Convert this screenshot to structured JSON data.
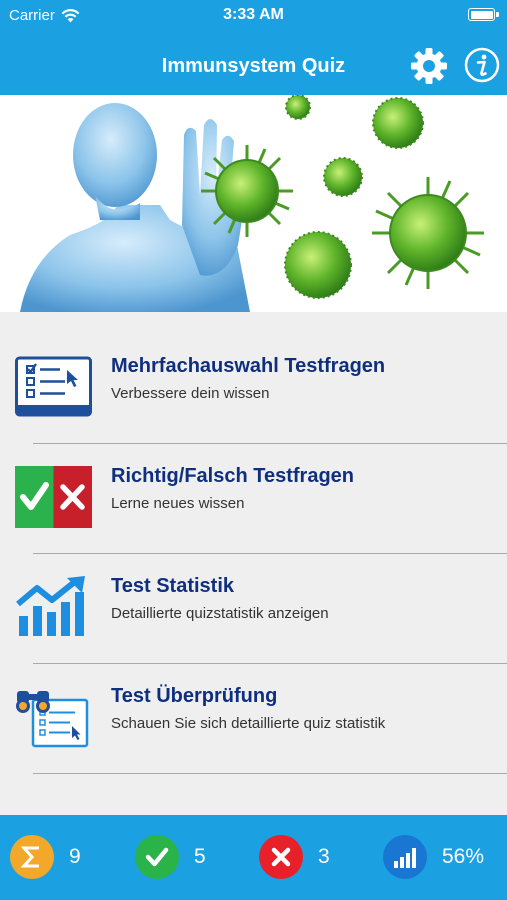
{
  "status_bar": {
    "carrier": "Carrier",
    "time": "3:33 AM"
  },
  "nav": {
    "title": "Immunsystem Quiz",
    "settings_icon": "gear-icon",
    "info_icon": "info-icon"
  },
  "menu": [
    {
      "title": "Mehrfachauswahl Testfragen",
      "subtitle": "Verbessere dein wissen",
      "icon": "checklist-icon"
    },
    {
      "title": "Richtig/Falsch Testfragen",
      "subtitle": "Lerne neues wissen",
      "icon": "true-false-icon"
    },
    {
      "title": "Test Statistik",
      "subtitle": "Detaillierte quizstatistik anzeigen",
      "icon": "chart-icon"
    },
    {
      "title": "Test Überprüfung",
      "subtitle": "Schauen Sie sich detaillierte quiz statistik",
      "icon": "binoculars-list-icon"
    }
  ],
  "stats": {
    "total": {
      "value": "9",
      "icon": "sigma-icon"
    },
    "correct": {
      "value": "5",
      "icon": "check-icon"
    },
    "wrong": {
      "value": "3",
      "icon": "x-icon"
    },
    "percent": {
      "value": "56%",
      "icon": "signal-bars-icon"
    }
  },
  "colors": {
    "primary": "#1ba1e2",
    "title_text": "#0f2f7e",
    "background": "#efefef",
    "sigma": "#f3a82a",
    "correct": "#29b349",
    "wrong": "#e8202a",
    "percent": "#1976d2"
  }
}
